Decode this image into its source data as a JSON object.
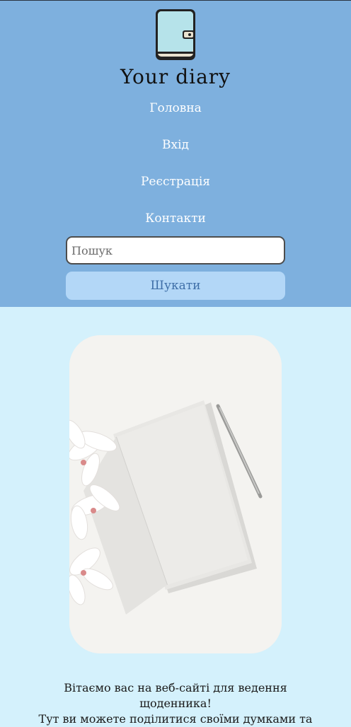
{
  "header": {
    "logo_icon": "diary-notebook-icon",
    "title": "Your diary",
    "nav": [
      {
        "label": "Головна"
      },
      {
        "label": "Вхід"
      },
      {
        "label": "Реєстрація"
      },
      {
        "label": "Контакти"
      }
    ],
    "search": {
      "placeholder": "Пошук",
      "value": "",
      "button_label": "Шукати"
    }
  },
  "hero": {
    "image": "notebook-with-pen-and-flowers-photo"
  },
  "welcome": {
    "line1": "Вітаємо вас на веб-сайті для ведення щоденника!",
    "line2": "Тут ви можете поділитися своїми думками та"
  },
  "colors": {
    "header_bg": "#7eb0de",
    "page_bg": "#d4f1fc",
    "button_bg": "#b3d7f7",
    "button_text": "#3f6fa8"
  }
}
